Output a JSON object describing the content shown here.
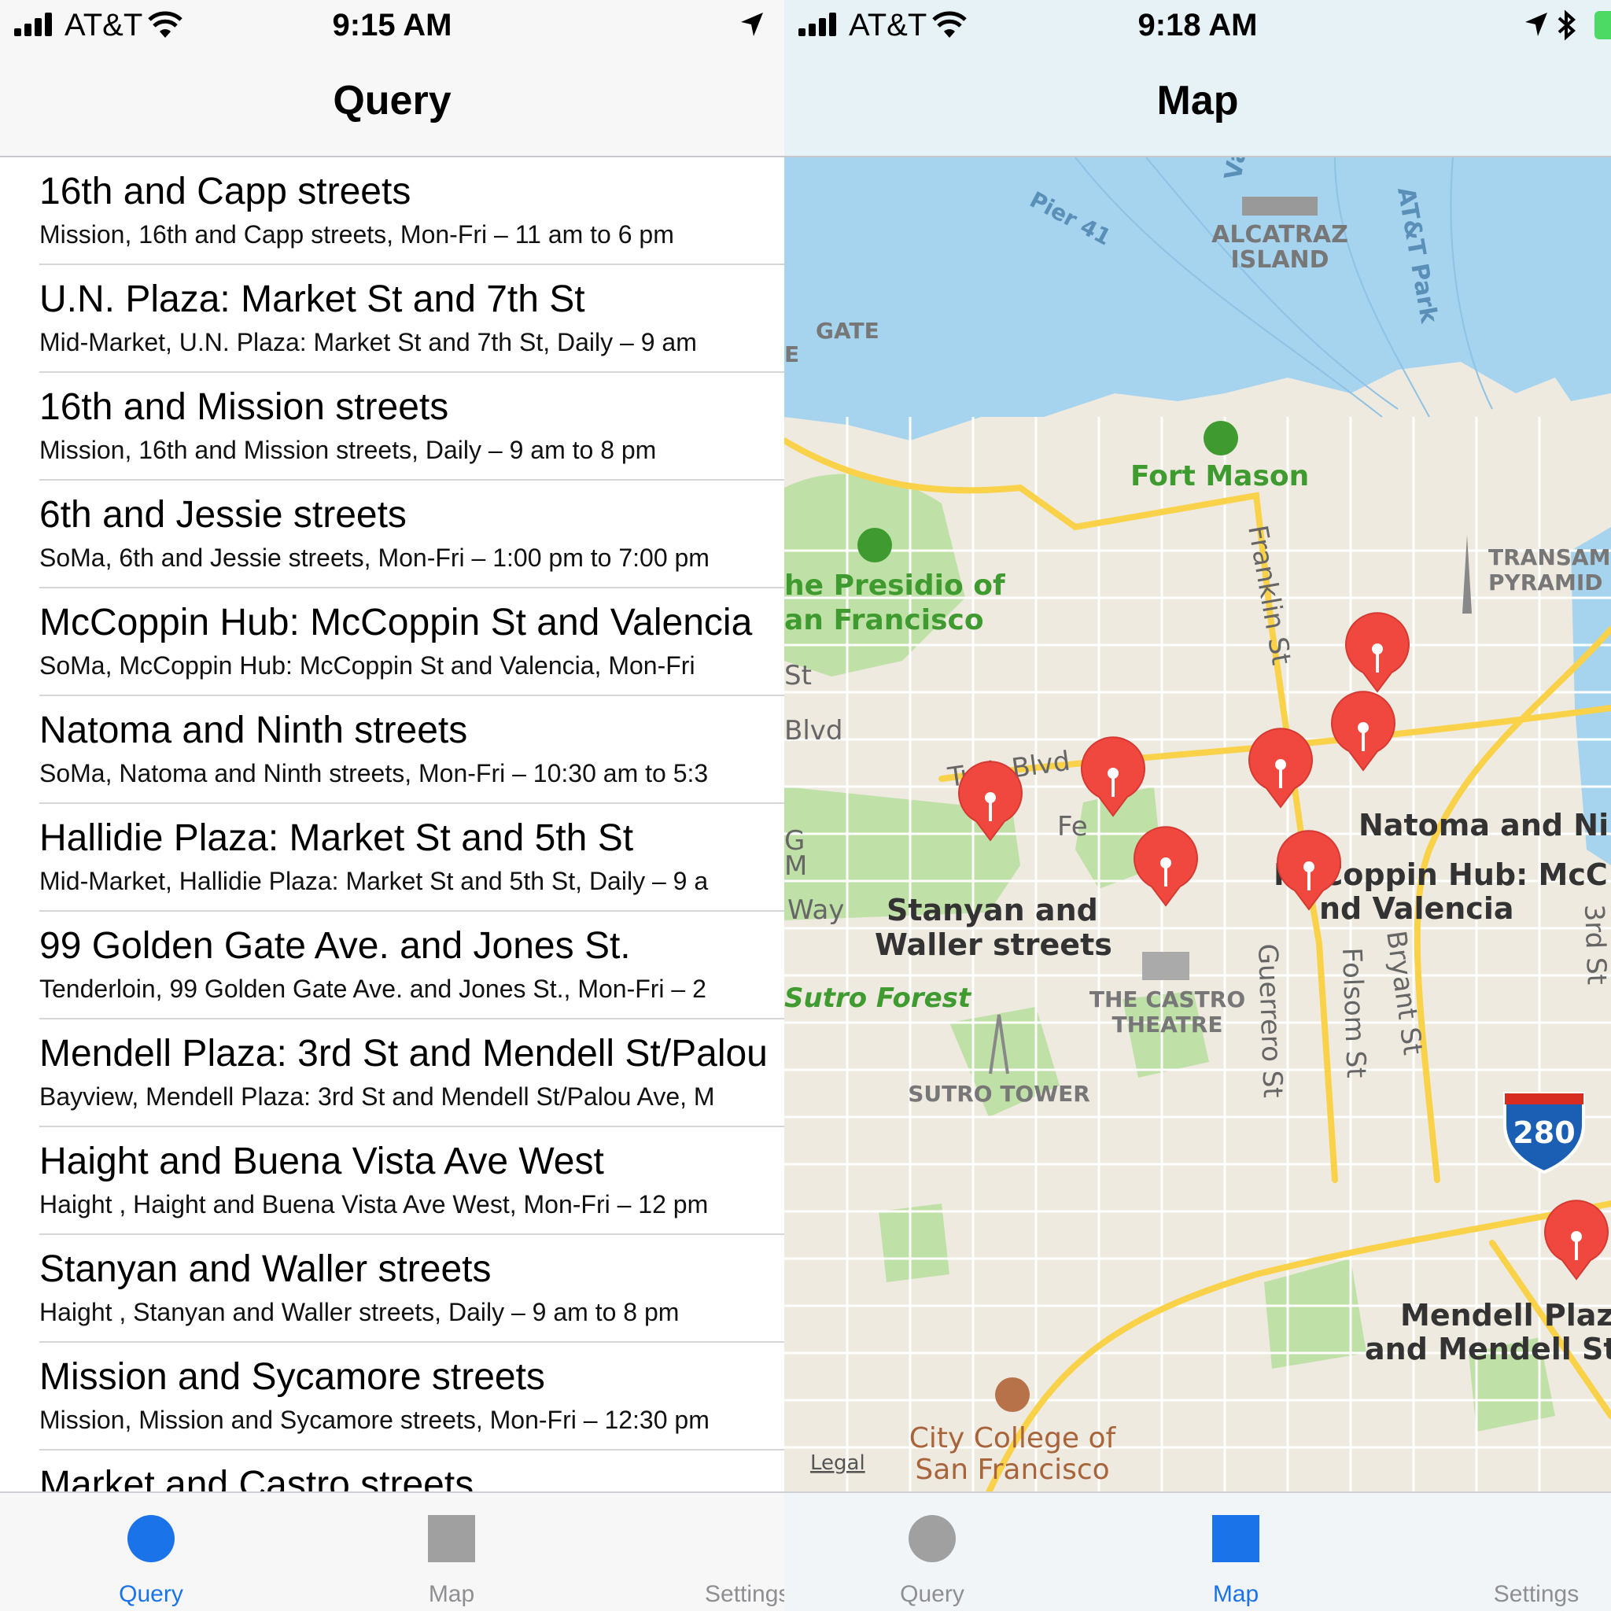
{
  "left": {
    "status": {
      "carrier": "AT&T",
      "time": "9:15 AM"
    },
    "title": "Query",
    "rows": [
      {
        "title": "16th and Capp streets",
        "subtitle": "Mission, 16th and Capp streets, Mon-Fri – 11 am to 6 pm"
      },
      {
        "title": "U.N. Plaza:  Market St and 7th St",
        "subtitle": "Mid-Market, U.N. Plaza:  Market St and 7th St, Daily – 9 am"
      },
      {
        "title": "16th and Mission streets",
        "subtitle": "Mission, 16th and Mission streets, Daily – 9 am to 8 pm"
      },
      {
        "title": "6th and Jessie streets",
        "subtitle": "SoMa, 6th and Jessie streets, Mon-Fri – 1:00 pm to 7:00 pm"
      },
      {
        "title": "McCoppin Hub:  McCoppin St and Valencia",
        "subtitle": "SoMa, McCoppin Hub:  McCoppin St and Valencia, Mon-Fri"
      },
      {
        "title": "Natoma and Ninth streets",
        "subtitle": "SoMa, Natoma and Ninth streets, Mon-Fri – 10:30 am to 5:3"
      },
      {
        "title": "Hallidie Plaza: Market St and 5th St",
        "subtitle": "Mid-Market, Hallidie Plaza: Market St and 5th St, Daily – 9 a"
      },
      {
        "title": "99 Golden Gate Ave. and Jones St.",
        "subtitle": "Tenderloin, 99 Golden Gate Ave. and Jones St., Mon-Fri – 2"
      },
      {
        "title": "Mendell Plaza: 3rd St and Mendell St/Palou",
        "subtitle": "Bayview, Mendell Plaza: 3rd St and Mendell St/Palou Ave, M"
      },
      {
        "title": "Haight and Buena Vista Ave West",
        "subtitle": "Haight , Haight and Buena Vista Ave West, Mon-Fri – 12 pm"
      },
      {
        "title": "Stanyan and Waller streets",
        "subtitle": "Haight , Stanyan and Waller streets, Daily – 9 am to 8 pm"
      },
      {
        "title": "Mission and Sycamore streets",
        "subtitle": "Mission, Mission and Sycamore streets, Mon-Fri – 12:30 pm"
      },
      {
        "title": "Market and Castro streets",
        "subtitle": ""
      }
    ],
    "tabs": [
      {
        "label": "Query",
        "icon": "circle-icon",
        "color": "#1a73e8"
      },
      {
        "label": "Map",
        "icon": "square-icon",
        "color": "#8e8e93"
      },
      {
        "label": "Settings",
        "icon": "settings-icon",
        "color": "#8e8e93"
      }
    ]
  },
  "right": {
    "status": {
      "carrier": "AT&T",
      "time": "9:18 AM"
    },
    "title": "Map",
    "map_labels": {
      "pier": "Pier 41",
      "alcatraz1": "ALCATRAZ",
      "alcatraz2": "ISLAND",
      "park": "AT&T Park",
      "valle": "Valle",
      "gate1": "GATE",
      "gate2": "E",
      "fort_mason": "Fort Mason",
      "presidio1": "he Presidio of",
      "presidio2": "an Francisco",
      "franklin": "Franklin St",
      "transam1": "TRANSAM",
      "transam2": "PYRAMID",
      "st": "St",
      "blvd": "Blvd",
      "turk": "Turk Blvd",
      "fe": "Fe",
      "g": "G",
      "m": "M",
      "way": "Way",
      "stanyan1": "Stanyan and",
      "stanyan2": "Waller streets",
      "natoma": "Natoma and Ni",
      "mccoppin1": "McCoppin Hub:  McC",
      "mccoppin2": "nd Valencia",
      "third": "3rd St",
      "sutro_forest": "Sutro Forest",
      "castro1": "THE CASTRO",
      "castro2": "THEATRE",
      "guerrero": "Guerrero St",
      "folsom": "Folsom St",
      "bryant": "Bryant St",
      "sutro_tower": "SUTRO TOWER",
      "i280": "280",
      "mendell1": "Mendell Plaz",
      "mendell2": "and Mendell St",
      "ccsf1": "City College of",
      "ccsf2": "San Francisco",
      "legal": "Legal"
    },
    "tabs": [
      {
        "label": "Query",
        "icon": "circle-icon",
        "color": "#8e8e93"
      },
      {
        "label": "Map",
        "icon": "square-icon",
        "color": "#1a73e8"
      },
      {
        "label": "Settings",
        "icon": "settings-icon",
        "color": "#8e8e93"
      }
    ],
    "colors": {
      "water": "#a6d3ee",
      "land": "#efeae0",
      "park": "#bfe0a6",
      "road": "#f9d24a",
      "pin": "#f0483f",
      "park_label": "#3f9a2f"
    }
  }
}
